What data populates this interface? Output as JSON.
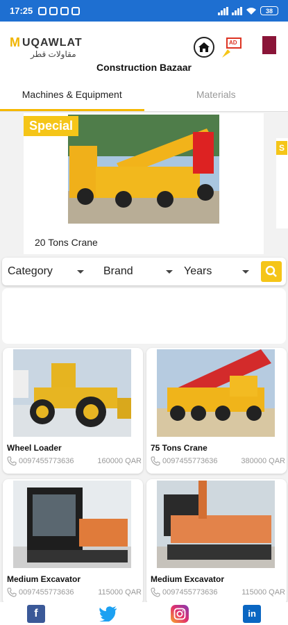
{
  "status_bar": {
    "time": "17:25",
    "battery": "38"
  },
  "header": {
    "logo_en": "UQAWLAT",
    "logo_mark": "M",
    "logo_ar": "مقاولات قطر",
    "title": "Construction Bazaar",
    "ad_label": "AD"
  },
  "tabs": [
    {
      "label": "Machines & Equipment",
      "active": true
    },
    {
      "label": "Materials",
      "active": false
    }
  ],
  "featured": {
    "badge": "Special",
    "badge_peek": "S",
    "caption": "20 Tons Crane"
  },
  "filters": {
    "category": "Category",
    "brand": "Brand",
    "years": "Years"
  },
  "listings": [
    {
      "name": "Wheel Loader",
      "phone": "0097455773636",
      "price": "160000 QAR"
    },
    {
      "name": "75 Tons Crane",
      "phone": "0097455773636",
      "price": "380000 QAR"
    },
    {
      "name": "Medium Excavator",
      "phone": "0097455773636",
      "price": "115000 QAR"
    },
    {
      "name": "Medium Excavator",
      "phone": "0097455773636",
      "price": "115000 QAR"
    }
  ],
  "social": {
    "facebook": "f",
    "twitter": "twitter-icon",
    "instagram": "instagram-icon",
    "linkedin": "in"
  },
  "colors": {
    "accent": "#f5c518",
    "status_bar": "#1e6fd1",
    "flag": "#8a1538"
  }
}
